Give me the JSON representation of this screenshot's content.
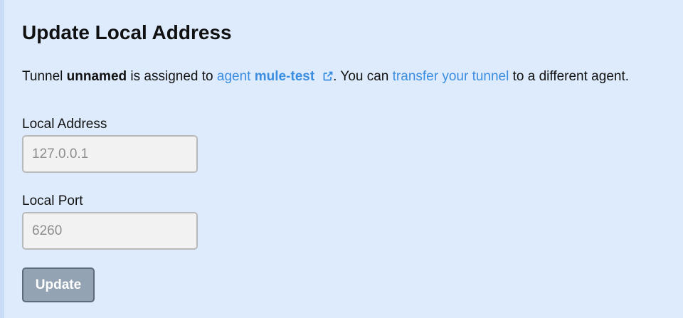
{
  "page": {
    "title": "Update Local Address"
  },
  "description": {
    "prefix": "Tunnel ",
    "tunnel_name": "unnamed",
    "middle": " is assigned to ",
    "agent_link_prefix": "agent ",
    "agent_name": "mule-test",
    "after_agent": ". You can ",
    "transfer_link": "transfer your tunnel",
    "suffix": " to a different agent.",
    "external_link_icon": "external-link-icon"
  },
  "form": {
    "local_address": {
      "label": "Local Address",
      "placeholder": "127.0.0.1",
      "value": ""
    },
    "local_port": {
      "label": "Local Port",
      "placeholder": "6260",
      "value": ""
    },
    "submit_label": "Update"
  },
  "colors": {
    "background": "#ddebfc",
    "link": "#3b8de0",
    "button_bg": "#94a3b3",
    "button_border": "#5d6b7b",
    "input_bg": "#f2f2f2"
  }
}
